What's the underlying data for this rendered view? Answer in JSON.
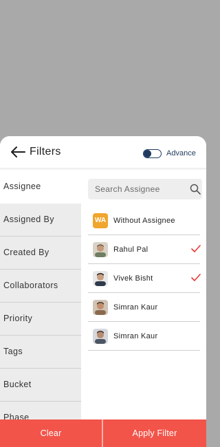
{
  "header": {
    "back_icon": "arrow-left-icon",
    "title": "Filters",
    "advance_label": "Advance",
    "advance_toggle_on": false,
    "accent_color": "#1e3a5f"
  },
  "categories": [
    {
      "label": "Assignee",
      "active": true
    },
    {
      "label": "Assigned By",
      "active": false
    },
    {
      "label": "Created By",
      "active": false
    },
    {
      "label": "Collaborators",
      "active": false
    },
    {
      "label": "Priority",
      "active": false
    },
    {
      "label": "Tags",
      "active": false
    },
    {
      "label": "Bucket",
      "active": false
    },
    {
      "label": "Phase",
      "active": false
    }
  ],
  "search": {
    "placeholder": "Search Assignee",
    "value": "",
    "icon": "search-icon"
  },
  "assignees": [
    {
      "name": "Without Assignee",
      "initials": "WA",
      "checked": false
    },
    {
      "name": "Rahul Pal",
      "checked": true
    },
    {
      "name": "Vivek Bisht",
      "checked": true
    },
    {
      "name": "Simran Kaur",
      "checked": false
    },
    {
      "name": "Simran Kaur",
      "checked": false
    }
  ],
  "footer": {
    "clear_label": "Clear",
    "apply_label": "Apply Filter",
    "color": "#f2544a"
  },
  "check_color": "#e53935"
}
